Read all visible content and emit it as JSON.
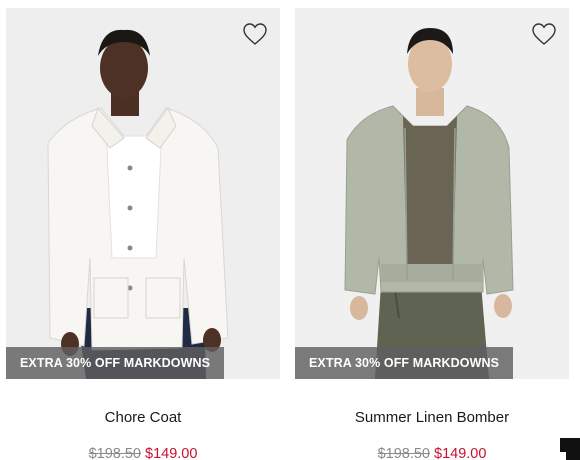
{
  "products": [
    {
      "name": "Chore Coat",
      "badge": "EXTRA 30% OFF MARKDOWNS",
      "original_price": "$198.50",
      "sale_price": "$149.00",
      "image_alt": "Model wearing white chore coat"
    },
    {
      "name": "Summer Linen Bomber",
      "badge": "EXTRA 30% OFF MARKDOWNS",
      "original_price": "$198.50",
      "sale_price": "$149.00",
      "image_alt": "Model wearing sage linen bomber jacket"
    }
  ],
  "icons": {
    "wishlist": "heart-outline-icon",
    "chat": "chat-widget-icon"
  },
  "colors": {
    "sale_price": "#c8102e",
    "original_price": "#8a8a8a",
    "badge_bg": "#5f5f5f",
    "badge_text": "#ffffff"
  }
}
